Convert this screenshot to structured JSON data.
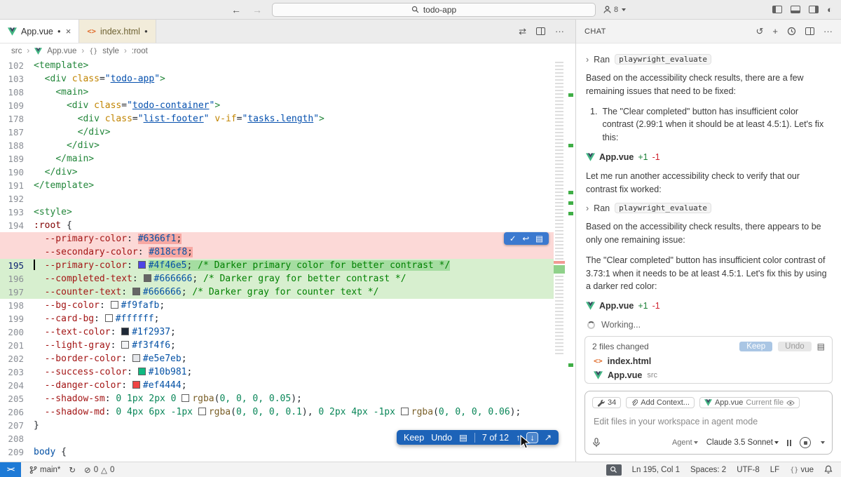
{
  "colors": {
    "accent": "#005fb8",
    "added_bg": "#d7efcf",
    "removed_bg": "#fcd9d7",
    "vue_green": "#41B883",
    "html_orange": "#e06c2b"
  },
  "icons": {
    "back": "←",
    "forward": "→",
    "close": "×",
    "dot": "●",
    "sep": "›",
    "chev_right": "›",
    "more": "···",
    "plus": "+",
    "discard": "↺",
    "compare": "⇄",
    "check": "✓",
    "revert": "↩",
    "doc": "▤",
    "up": "↑",
    "down": "↓",
    "open_side": "↗",
    "half": "◐",
    "error": "⊘",
    "warning": "△",
    "sync": "↻",
    "braces": "{}",
    "angle": "<>",
    "remote": "><"
  },
  "titlebar": {
    "search": "todo-app",
    "account_badge": "8"
  },
  "tabs": [
    {
      "name": "App.vue"
    },
    {
      "name": "index.html"
    }
  ],
  "breadcrumb": {
    "src": "src",
    "file": "App.vue",
    "section": "style",
    "selector": ":root"
  },
  "editor": {
    "active_line": "195",
    "diff_widget": {
      "keep": "Keep",
      "undo": "Undo",
      "counter": "7 of 12"
    },
    "overview_marks": [
      49,
      121,
      188,
      203,
      218,
      434
    ],
    "lines": [
      {
        "n": "102",
        "tk": [
          [
            "tag",
            "<template>"
          ]
        ]
      },
      {
        "n": "103",
        "tk": [
          [
            "pln",
            "  "
          ],
          [
            "tag",
            "<div "
          ],
          [
            "attr",
            "class"
          ],
          [
            "pun",
            "="
          ],
          [
            "str",
            "\""
          ],
          [
            "lnk",
            "todo-app"
          ],
          [
            "str",
            "\""
          ],
          [
            "tag",
            ">"
          ]
        ]
      },
      {
        "n": "108",
        "tk": [
          [
            "pln",
            "    "
          ],
          [
            "tag",
            "<main>"
          ]
        ]
      },
      {
        "n": "109",
        "tk": [
          [
            "pln",
            "      "
          ],
          [
            "tag",
            "<div "
          ],
          [
            "attr",
            "class"
          ],
          [
            "pun",
            "="
          ],
          [
            "str",
            "\""
          ],
          [
            "lnk",
            "todo-container"
          ],
          [
            "str",
            "\""
          ],
          [
            "tag",
            ">"
          ]
        ]
      },
      {
        "n": "178",
        "tk": [
          [
            "pln",
            "        "
          ],
          [
            "tag",
            "<div "
          ],
          [
            "attr",
            "class"
          ],
          [
            "pun",
            "="
          ],
          [
            "str",
            "\""
          ],
          [
            "lnk",
            "list-footer"
          ],
          [
            "str",
            "\""
          ],
          [
            "pln",
            " "
          ],
          [
            "attr",
            "v-if"
          ],
          [
            "pun",
            "="
          ],
          [
            "str",
            "\""
          ],
          [
            "lnk",
            "tasks.length"
          ],
          [
            "str",
            "\""
          ],
          [
            "tag",
            ">"
          ]
        ]
      },
      {
        "n": "187",
        "tk": [
          [
            "pln",
            "        "
          ],
          [
            "tag",
            "</div>"
          ]
        ]
      },
      {
        "n": "188",
        "tk": [
          [
            "pln",
            "      "
          ],
          [
            "tag",
            "</div>"
          ]
        ]
      },
      {
        "n": "189",
        "tk": [
          [
            "pln",
            "    "
          ],
          [
            "tag",
            "</main>"
          ]
        ]
      },
      {
        "n": "190",
        "tk": [
          [
            "pln",
            "  "
          ],
          [
            "tag",
            "</div>"
          ]
        ]
      },
      {
        "n": "191",
        "tk": [
          [
            "tag",
            "</template>"
          ]
        ]
      },
      {
        "n": "192",
        "tk": []
      },
      {
        "n": "193",
        "tk": [
          [
            "tag",
            "<style>"
          ]
        ]
      },
      {
        "n": "194",
        "tk": [
          [
            "sel",
            ":root"
          ],
          [
            "pln",
            " {"
          ]
        ]
      },
      {
        "n": "",
        "bg": "del",
        "tk": [
          [
            "pln",
            "  "
          ],
          [
            "prop",
            "--primary-color"
          ],
          [
            "pun",
            ": "
          ],
          [
            "val",
            "#6366f1",
            1
          ],
          [
            "pun",
            ";",
            1
          ]
        ]
      },
      {
        "n": "",
        "bg": "del",
        "tk": [
          [
            "pln",
            "  "
          ],
          [
            "prop",
            "--secondary-color"
          ],
          [
            "pun",
            ": "
          ],
          [
            "val",
            "#818cf8",
            1
          ],
          [
            "pun",
            ";",
            1
          ]
        ]
      },
      {
        "n": "195",
        "bg": "add",
        "cur": 1,
        "tk": [
          [
            "pln",
            "  "
          ],
          [
            "prop",
            "--primary-color"
          ],
          [
            "pun",
            ": "
          ],
          [
            "sw",
            "#4f46e5",
            1
          ],
          [
            "val",
            "#4f46e5",
            1
          ],
          [
            "pun",
            ";",
            1
          ],
          [
            "cmt",
            " /* Darker primary color for better contrast */",
            1
          ]
        ]
      },
      {
        "n": "196",
        "bg": "add",
        "tk": [
          [
            "pln",
            "  "
          ],
          [
            "prop",
            "--completed-text"
          ],
          [
            "pun",
            ": "
          ],
          [
            "sw",
            "#666666"
          ],
          [
            "val",
            "#666666"
          ],
          [
            "pun",
            ";"
          ],
          [
            "cmt",
            " /* Darker gray for better contrast */"
          ]
        ]
      },
      {
        "n": "197",
        "bg": "add",
        "tk": [
          [
            "pln",
            "  "
          ],
          [
            "prop",
            "--counter-text"
          ],
          [
            "pun",
            ": "
          ],
          [
            "sw",
            "#666666"
          ],
          [
            "val",
            "#666666"
          ],
          [
            "pun",
            ";"
          ],
          [
            "cmt",
            " /* Darker gray for counter text */"
          ]
        ]
      },
      {
        "n": "198",
        "tk": [
          [
            "pln",
            "  "
          ],
          [
            "prop",
            "--bg-color"
          ],
          [
            "pun",
            ": "
          ],
          [
            "sw",
            "#f9fafb"
          ],
          [
            "val",
            "#f9fafb"
          ],
          [
            "pun",
            ";"
          ]
        ]
      },
      {
        "n": "199",
        "tk": [
          [
            "pln",
            "  "
          ],
          [
            "prop",
            "--card-bg"
          ],
          [
            "pun",
            ": "
          ],
          [
            "sw",
            "#ffffff"
          ],
          [
            "val",
            "#ffffff"
          ],
          [
            "pun",
            ";"
          ]
        ]
      },
      {
        "n": "200",
        "tk": [
          [
            "pln",
            "  "
          ],
          [
            "prop",
            "--text-color"
          ],
          [
            "pun",
            ": "
          ],
          [
            "sw",
            "#1f2937"
          ],
          [
            "val",
            "#1f2937"
          ],
          [
            "pun",
            ";"
          ]
        ]
      },
      {
        "n": "201",
        "tk": [
          [
            "pln",
            "  "
          ],
          [
            "prop",
            "--light-gray"
          ],
          [
            "pun",
            ": "
          ],
          [
            "sw",
            "#f3f4f6"
          ],
          [
            "val",
            "#f3f4f6"
          ],
          [
            "pun",
            ";"
          ]
        ]
      },
      {
        "n": "202",
        "tk": [
          [
            "pln",
            "  "
          ],
          [
            "prop",
            "--border-color"
          ],
          [
            "pun",
            ": "
          ],
          [
            "sw",
            "#e5e7eb"
          ],
          [
            "val",
            "#e5e7eb"
          ],
          [
            "pun",
            ";"
          ]
        ]
      },
      {
        "n": "203",
        "tk": [
          [
            "pln",
            "  "
          ],
          [
            "prop",
            "--success-color"
          ],
          [
            "pun",
            ": "
          ],
          [
            "sw",
            "#10b981"
          ],
          [
            "val",
            "#10b981"
          ],
          [
            "pun",
            ";"
          ]
        ]
      },
      {
        "n": "204",
        "tk": [
          [
            "pln",
            "  "
          ],
          [
            "prop",
            "--danger-color"
          ],
          [
            "pun",
            ": "
          ],
          [
            "sw",
            "#ef4444"
          ],
          [
            "val",
            "#ef4444"
          ],
          [
            "pun",
            ";"
          ]
        ]
      },
      {
        "n": "205",
        "tk": [
          [
            "pln",
            "  "
          ],
          [
            "prop",
            "--shadow-sm"
          ],
          [
            "pun",
            ": "
          ],
          [
            "num",
            "0 1px 2px 0"
          ],
          [
            "pln",
            " "
          ],
          [
            "sw",
            ""
          ],
          [
            "fn",
            "rgba"
          ],
          [
            "pun",
            "("
          ],
          [
            "num",
            "0, 0, 0, 0.05"
          ],
          [
            "pun",
            ");"
          ]
        ]
      },
      {
        "n": "206",
        "tk": [
          [
            "pln",
            "  "
          ],
          [
            "prop",
            "--shadow-md"
          ],
          [
            "pun",
            ": "
          ],
          [
            "num",
            "0 4px 6px -1px"
          ],
          [
            "pln",
            " "
          ],
          [
            "sw",
            ""
          ],
          [
            "fn",
            "rgba"
          ],
          [
            "pun",
            "("
          ],
          [
            "num",
            "0, 0, 0, 0.1"
          ],
          [
            "pun",
            "),"
          ],
          [
            "pln",
            " "
          ],
          [
            "num",
            "0 2px 4px -1px"
          ],
          [
            "pln",
            " "
          ],
          [
            "sw",
            ""
          ],
          [
            "fn",
            "rgba"
          ],
          [
            "pun",
            "("
          ],
          [
            "num",
            "0, 0, 0, 0.06"
          ],
          [
            "pun",
            ");"
          ]
        ]
      },
      {
        "n": "207",
        "tk": [
          [
            "pln",
            "}"
          ]
        ]
      },
      {
        "n": "208",
        "tk": []
      },
      {
        "n": "209",
        "tk": [
          [
            "sel2",
            "body"
          ],
          [
            "pln",
            " {"
          ]
        ]
      }
    ]
  },
  "chat": {
    "title": "CHAT",
    "messages": [
      {
        "type": "tool",
        "label": "Ran",
        "code": "playwright_evaluate"
      },
      {
        "type": "p",
        "text": "Based on the accessibility check results, there are a few remaining issues that need to be fixed:"
      },
      {
        "type": "li",
        "marker": "1.",
        "text": "The \"Clear completed\" button has insufficient color contrast (2.99:1 when it should be at least 4.5:1). Let's fix this:"
      },
      {
        "type": "file",
        "name": "App.vue",
        "added": "+1",
        "removed": "-1"
      },
      {
        "type": "p",
        "text": "Let me run another accessibility check to verify that our contrast fix worked:"
      },
      {
        "type": "tool",
        "label": "Ran",
        "code": "playwright_evaluate"
      },
      {
        "type": "p",
        "text": "Based on the accessibility check results, there appears to be only one remaining issue:"
      },
      {
        "type": "p",
        "text": "The \"Clear completed\" button has insufficient color contrast of 3.73:1 when it needs to be at least 4.5:1. Let's fix this by using a darker red color:"
      },
      {
        "type": "file",
        "name": "App.vue",
        "added": "+1",
        "removed": "-1"
      },
      {
        "type": "working",
        "text": "Working..."
      }
    ],
    "changes_card": {
      "title": "2 files changed",
      "keep": "Keep",
      "undo": "Undo",
      "files": [
        {
          "icon": "html",
          "name": "index.html",
          "suffix": ""
        },
        {
          "icon": "vue",
          "name": "App.vue",
          "suffix": "src"
        }
      ]
    },
    "input": {
      "tools_count": "34",
      "add_context": "Add Context...",
      "current_file_name": "App.vue",
      "current_file_label": "Current file",
      "placeholder": "Edit files in your workspace in agent mode",
      "agent": "Agent",
      "model": "Claude 3.5 Sonnet"
    }
  },
  "statusbar": {
    "branch": "main*",
    "errors": "0",
    "warnings": "0",
    "line_col": "Ln 195, Col 1",
    "spaces": "Spaces: 2",
    "encoding": "UTF-8",
    "eol": "LF",
    "lang": "vue",
    "lang_braces": "{}"
  }
}
